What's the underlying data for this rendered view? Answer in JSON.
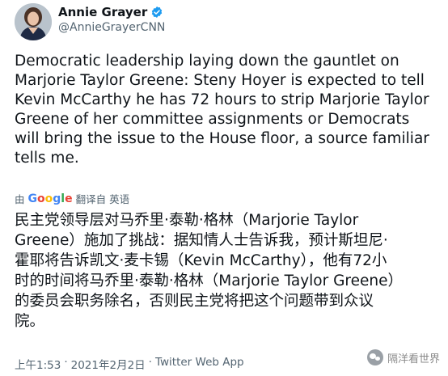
{
  "author": {
    "display_name": "Annie Grayer",
    "handle": "@AnnieGrayerCNN",
    "verified_icon": "verified-badge-icon",
    "badge_color": "#1d9bf0"
  },
  "tweet": {
    "text": "Democratic leadership laying down the gauntlet on\nMarjorie Taylor Greene: Steny Hoyer is expected to tell\nKevin McCarthy he has 72 hours to strip Marjorie Taylor\nGreene of her committee assignments or Democrats\nwill bring the issue to the House floor, a source familiar\ntells me."
  },
  "translation": {
    "prefix": "由",
    "provider_letters": [
      "G",
      "o",
      "o",
      "g",
      "l",
      "e"
    ],
    "action": "翻译自 英语",
    "text": "民主党领导层对马乔里·泰勒·格林（Marjorie Taylor\nGreene）施加了挑战：据知情人士告诉我，预计斯坦尼·\n霍耶将告诉凯文·麦卡锡（Kevin McCarthy），他有72小\n时的时间将马乔里·泰勒·格林（Marjorie Taylor Greene）\n的委员会职务除名，否则民主党将把这个问题带到众议\n院。"
  },
  "meta": {
    "time": "上午1:53",
    "separator1": "·",
    "date": "2021年2月2日",
    "separator2": "·",
    "source": "Twitter Web App"
  },
  "watermark": {
    "text": "隔洋看世界"
  },
  "colors": {
    "text": "#0f1419",
    "secondary": "#536471",
    "google_blue": "#4285f4",
    "google_red": "#ea4335",
    "google_yellow": "#fbbc05",
    "google_green": "#34a853"
  }
}
